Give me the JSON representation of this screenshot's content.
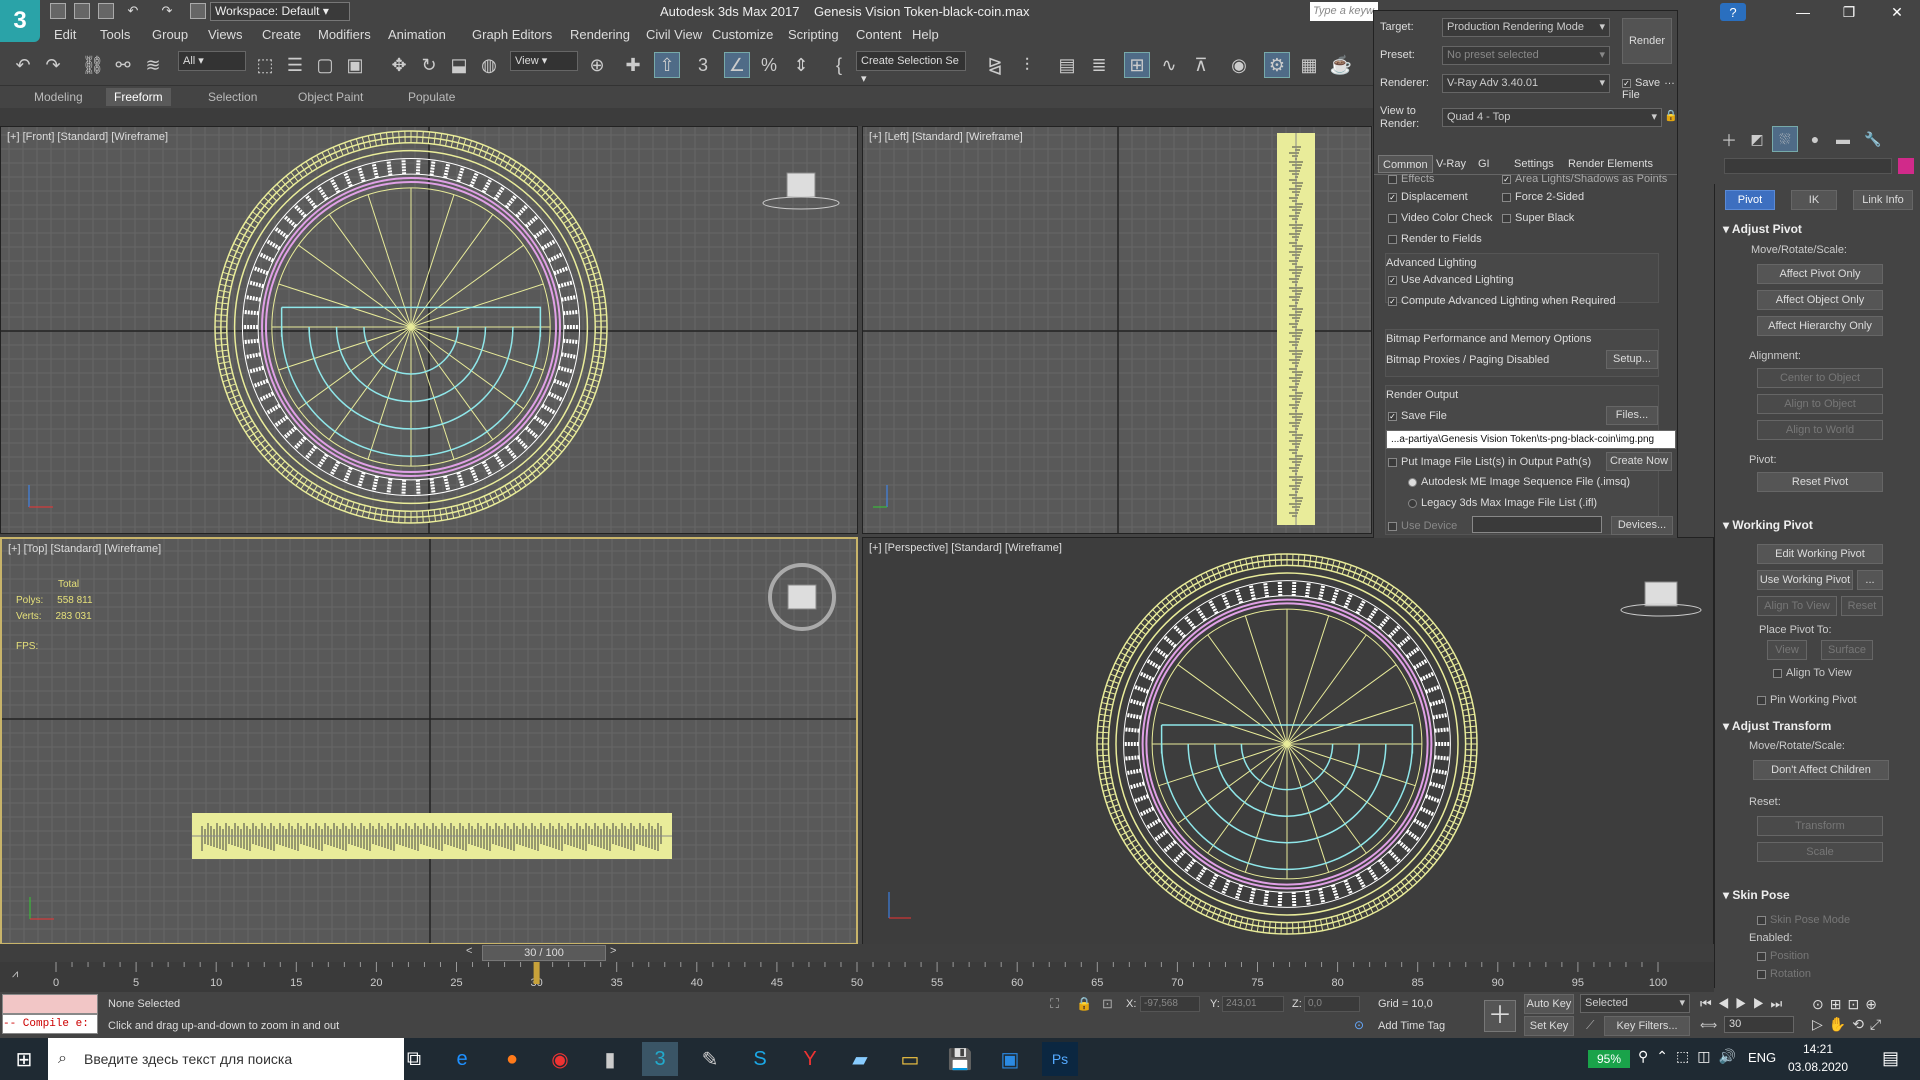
{
  "title": {
    "app": "Autodesk 3ds Max 2017",
    "file": "Genesis Vision Token-black-coin.max",
    "workspace": "Workspace: Default",
    "search_placeholder": "Type a keyw",
    "logo": "3"
  },
  "menu": [
    "Edit",
    "Tools",
    "Group",
    "Views",
    "Create",
    "Modifiers",
    "Animation",
    "Graph Editors",
    "Rendering",
    "Civil View",
    "Customize",
    "Scripting",
    "Content",
    "Help"
  ],
  "toolbar": {
    "filter": "All",
    "refcoord": "View",
    "selection_set": "Create Selection Se"
  },
  "ribbon_tabs": [
    "Modeling",
    "Freeform",
    "Selection",
    "Object Paint",
    "Populate"
  ],
  "viewports": {
    "front": "[+] [Front] [Standard] [Wireframe]",
    "left": "[+] [Left] [Standard] [Wireframe]",
    "top": "[+] [Top] [Standard] [Wireframe]",
    "persp": "[+] [Perspective] [Standard] [Wireframe]",
    "stats": {
      "total_label": "Total",
      "polys_label": "Polys:",
      "polys": "558 811",
      "verts_label": "Verts:",
      "verts": "283 031",
      "fps_label": "FPS:"
    }
  },
  "render": {
    "target_label": "Target:",
    "target": "Production Rendering Mode",
    "preset_label": "Preset:",
    "preset": "No preset selected",
    "renderer_label": "Renderer:",
    "renderer": "V-Ray Adv 3.40.01",
    "save_file_top": "Save File",
    "view_label": "View to\nRender:",
    "view": "Quad 4 - Top",
    "render_btn": "Render",
    "tabs": [
      "Common",
      "V-Ray",
      "GI",
      "Settings",
      "Render Elements"
    ],
    "opts": {
      "effects": "Effects",
      "area_lights": "Area Lights/Shadows as Points",
      "displacement": "Displacement",
      "force2": "Force 2-Sided",
      "video_color": "Video Color Check",
      "super_black": "Super Black",
      "render_fields": "Render to Fields"
    },
    "adv_lighting": {
      "title": "Advanced Lighting",
      "use": "Use Advanced Lighting",
      "compute": "Compute Advanced Lighting when Required"
    },
    "bitmap": {
      "title": "Bitmap Performance and Memory Options",
      "status": "Bitmap Proxies / Paging Disabled",
      "setup": "Setup..."
    },
    "output": {
      "title": "Render Output",
      "save_file": "Save File",
      "files": "Files...",
      "path": "...a-partiya\\Genesis Vision Token\\ts-png-black-coin\\img.png",
      "put_list": "Put Image File List(s) in Output Path(s)",
      "create_now": "Create Now",
      "autodesk_seq": "Autodesk ME Image Sequence File (.imsq)",
      "legacy": "Legacy 3ds Max Image File List (.ifl)",
      "use_device": "Use Device",
      "devices": "Devices..."
    }
  },
  "cmd": {
    "tabs": [
      "Pivot",
      "IK",
      "Link Info"
    ],
    "adjust_pivot": "Adjust Pivot",
    "move_rotate": "Move/Rotate/Scale:",
    "affect_pivot": "Affect Pivot Only",
    "affect_object": "Affect Object Only",
    "affect_hierarchy": "Affect Hierarchy Only",
    "alignment": "Alignment:",
    "center_obj": "Center to Object",
    "align_obj": "Align to Object",
    "align_world": "Align to World",
    "pivot": "Pivot:",
    "reset_pivot": "Reset Pivot",
    "working_pivot": "Working Pivot",
    "edit_wp": "Edit Working Pivot",
    "use_wp": "Use Working Pivot",
    "dots": "...",
    "align_view": "Align To View",
    "reset": "Reset",
    "place_pivot": "Place Pivot To:",
    "view": "View",
    "surface": "Surface",
    "align_to_view": "Align To View",
    "pin_wp": "Pin Working Pivot",
    "adjust_transform": "Adjust Transform",
    "move_rotate2": "Move/Rotate/Scale:",
    "dont_affect": "Don't Affect Children",
    "reset_label": "Reset:",
    "transform": "Transform",
    "scale": "Scale",
    "skin_pose": "Skin Pose",
    "skin_pose_mode": "Skin Pose Mode",
    "enabled": "Enabled:",
    "position": "Position",
    "rotation": "Rotation"
  },
  "timeline": {
    "frame": "30 / 100",
    "current": 30,
    "ticks": [
      "0",
      "5",
      "10",
      "15",
      "20",
      "25",
      "30",
      "35",
      "40",
      "45",
      "50",
      "55",
      "60",
      "65",
      "70",
      "75",
      "80",
      "85",
      "90",
      "95",
      "100"
    ]
  },
  "status": {
    "compile": "-- Compile e:",
    "selected": "None Selected",
    "prompt": "Click and drag up-and-down to zoom in and out",
    "x_label": "X:",
    "x": "-97,568",
    "y_label": "Y:",
    "y": "243,01",
    "z_label": "Z:",
    "z": "0,0",
    "grid": "Grid = 10,0",
    "add_time_tag": "Add Time Tag",
    "auto_key": "Auto Key",
    "set_key": "Set Key",
    "selected_dd": "Selected",
    "key_filters": "Key Filters...",
    "frame_field": "30"
  },
  "taskbar": {
    "search": "Введите здесь текст для поиска",
    "battery": "95%",
    "lang": "ENG",
    "time": "14:21",
    "date": "03.08.2020"
  },
  "colors": {
    "wire_yellow": "#e9ec9a",
    "wire_cyan": "#8fe7ea",
    "wire_pink": "#e0a0e6",
    "wire_white": "#ffffff",
    "accent": "#c8b46a"
  }
}
